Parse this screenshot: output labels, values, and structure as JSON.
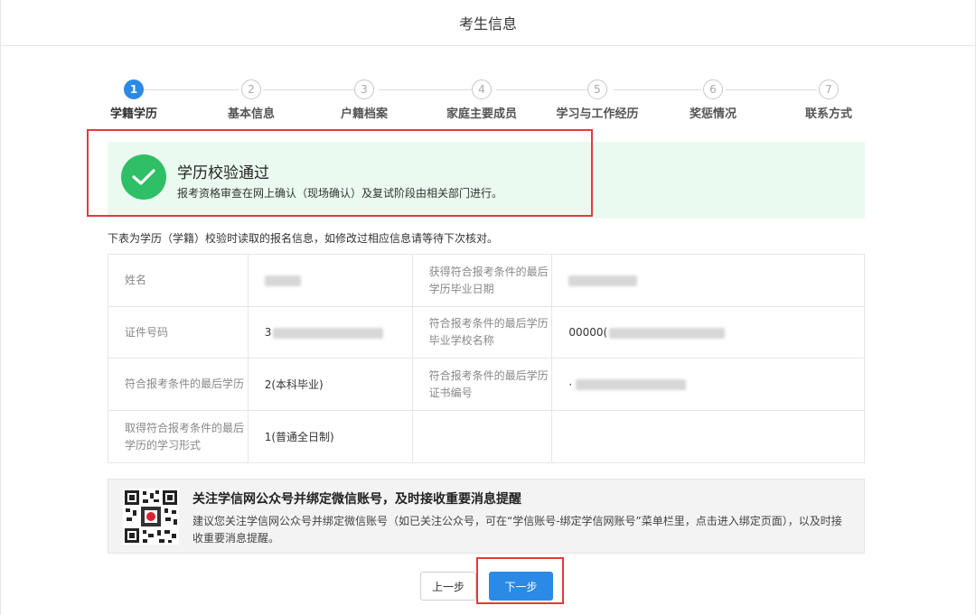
{
  "header": {
    "title": "考生信息"
  },
  "steps": [
    {
      "num": "1",
      "label": "学籍学历"
    },
    {
      "num": "2",
      "label": "基本信息"
    },
    {
      "num": "3",
      "label": "户籍档案"
    },
    {
      "num": "4",
      "label": "家庭主要成员"
    },
    {
      "num": "5",
      "label": "学习与工作经历"
    },
    {
      "num": "6",
      "label": "奖惩情况"
    },
    {
      "num": "7",
      "label": "联系方式"
    }
  ],
  "active_step": 1,
  "success": {
    "title": "学历校验通过",
    "desc": "报考资格审查在网上确认（现场确认）及复试阶段由相关部门进行。"
  },
  "notice": "下表为学历（学籍）校验时读取的报名信息，如修改过相应信息请等待下次核对。",
  "info": {
    "name_label": "姓名",
    "grad_date_label": "获得符合报考条件的最后学历毕业日期",
    "id_label": "证件号码",
    "id_value_prefix": "3",
    "school_label": "符合报考条件的最后学历毕业学校名称",
    "school_value_prefix": "00000(",
    "degree_label": "符合报考条件的最后学历",
    "degree_value": "2(本科毕业)",
    "cert_label": "符合报考条件的最后学历证书编号",
    "cert_value_prefix": "·",
    "form_label": "取得符合报考条件的最后学历的学习形式",
    "form_value": "1(普通全日制)"
  },
  "wechat": {
    "title": "关注学信网公众号并绑定微信账号，及时接收重要消息提醒",
    "desc": "建议您关注学信网公众号并绑定微信账号（如已关注公众号，可在“学信账号-绑定学信网账号”菜单栏里，点击进入绑定页面），以及时接收重要消息提醒。"
  },
  "buttons": {
    "prev": "上一步",
    "next": "下一步"
  },
  "colors": {
    "primary": "#2a8ae5",
    "success": "#2fbf66",
    "success_bg": "#eafaf0",
    "highlight": "#e33b36"
  }
}
